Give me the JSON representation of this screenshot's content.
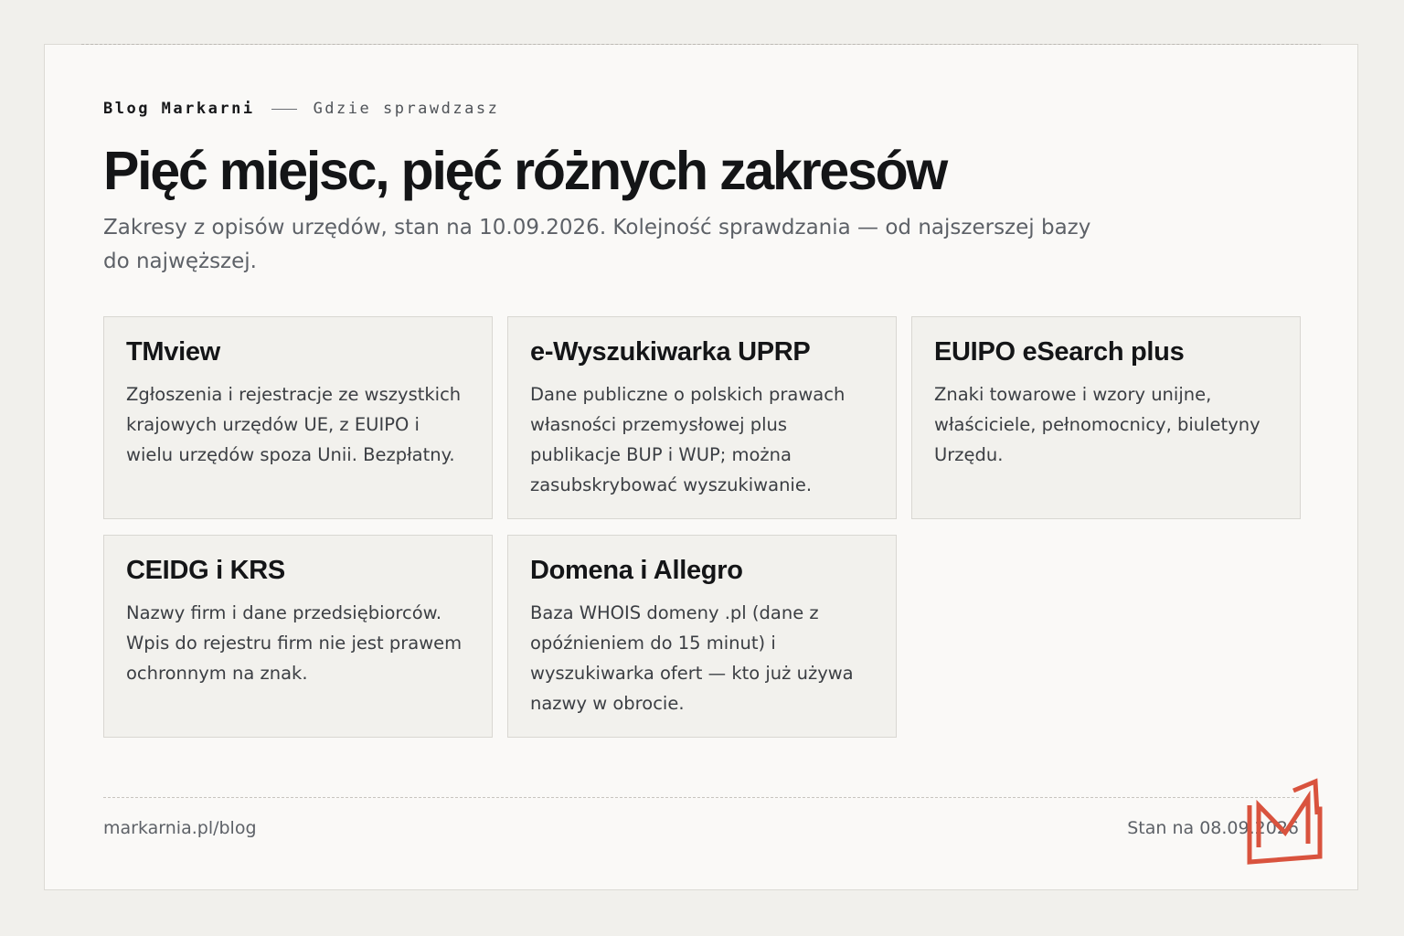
{
  "header": {
    "brand": "Blog Markarni",
    "section": "Gdzie sprawdzasz",
    "title": "Pięć miejsc, pięć różnych zakresów",
    "subtitle": "Zakresy z opisów urzędów, stan na 10.09.2026. Kolejność sprawdzania — od najszerszej bazy do najwęższej."
  },
  "sources": [
    {
      "title": "TMview",
      "description": "Zgłoszenia i rejestracje ze wszystkich krajowych urzędów UE, z EUIPO i wielu urzędów spoza Unii. Bezpłatny."
    },
    {
      "title": "e-Wyszukiwarka UPRP",
      "description": "Dane publiczne o polskich prawach własności przemysłowej plus publikacje BUP i WUP; można zasubskrybować wyszukiwanie."
    },
    {
      "title": "EUIPO eSearch plus",
      "description": "Znaki towarowe i wzory unijne, właściciele, pełnomocnicy, biuletyny Urzędu."
    },
    {
      "title": "CEIDG i KRS",
      "description": "Nazwy firm i dane przedsiębiorców. Wpis do rejestru firm nie jest prawem ochronnym na znak."
    },
    {
      "title": "Domena i Allegro",
      "description": "Baza WHOIS domeny .pl (dane z opóźnieniem do 15 minut) i wyszukiwarka ofert — kto już używa nazwy w obrocie."
    }
  ],
  "footer": {
    "url": "markarnia.pl/blog",
    "date": "Stan na 08.09.2026"
  },
  "logo": {
    "icon": "markarnia-m-logo",
    "color": "#d9533e"
  },
  "colors": {
    "page_background": "#f1f0ec",
    "card_background": "#faf9f7",
    "tile_background": "#f2f1ed",
    "accent": "#d9533e"
  }
}
